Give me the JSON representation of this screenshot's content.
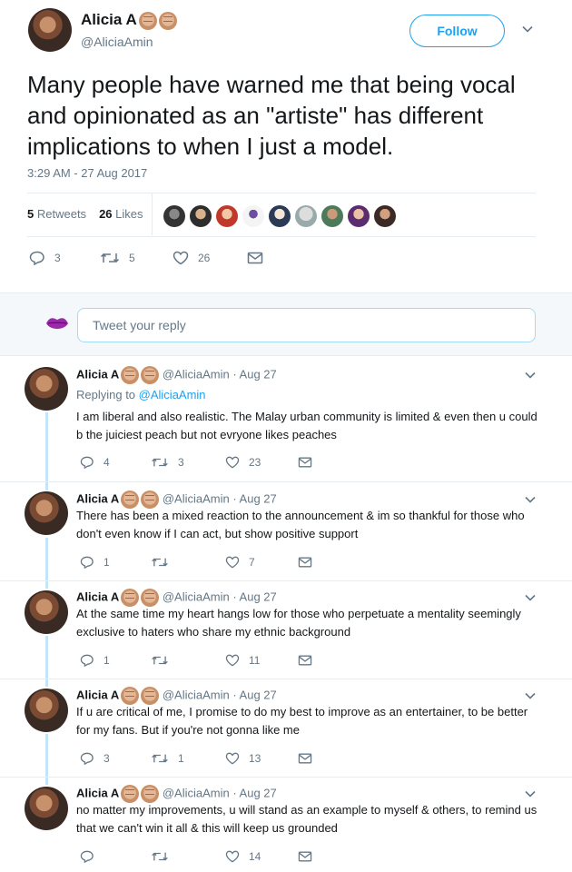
{
  "main": {
    "name": "Alicia A",
    "handle": "@AliciaAmin",
    "follow_label": "Follow",
    "text": "Many people have warned me that being vocal and opinionated as an \"artiste\" has different implications to when I just a model.",
    "time": "3:29 AM - 27 Aug 2017",
    "retweets_count": "5",
    "retweets_label": "Retweets",
    "likes_count": "26",
    "likes_label": "Likes",
    "reply_count": "3",
    "retweet_count": "5",
    "like_count": "26"
  },
  "reply_box": {
    "placeholder": "Tweet your reply"
  },
  "replies": [
    {
      "name": "Alicia A",
      "meta": "@AliciaAmin · Aug 27",
      "replying_prefix": "Replying to ",
      "replying_handle": "@AliciaAmin",
      "text": "I am liberal and also realistic. The Malay urban community is limited & even then u could b the juiciest peach but not evryone likes peaches",
      "replies": "4",
      "retweets": "3",
      "likes": "23"
    },
    {
      "name": "Alicia A",
      "meta": "@AliciaAmin · Aug 27",
      "text": "There has been a mixed reaction to the announcement & im so thankful for those who don't even know if I can act, but show positive support",
      "replies": "1",
      "retweets": "",
      "likes": "7"
    },
    {
      "name": "Alicia A",
      "meta": "@AliciaAmin · Aug 27",
      "text": "At the same time my heart hangs low for those who perpetuate a mentality seemingly exclusive to haters who share my ethnic background",
      "replies": "1",
      "retweets": "",
      "likes": "11"
    },
    {
      "name": "Alicia A",
      "meta": "@AliciaAmin · Aug 27",
      "text": "If u are critical of me, I promise to do my best to improve as an entertainer, to be better for my fans. But if you're not gonna like me",
      "replies": "3",
      "retweets": "1",
      "likes": "13"
    },
    {
      "name": "Alicia A",
      "meta": "@AliciaAmin · Aug 27",
      "text": "no matter my improvements, u will stand as an example to myself & others, to remind us that we can't win it all & this will keep us grounded",
      "replies": "",
      "retweets": "",
      "likes": "14"
    }
  ],
  "colors": {
    "accent": "#1da1f2",
    "muted": "#657786",
    "thread": "#c4e4f9"
  }
}
